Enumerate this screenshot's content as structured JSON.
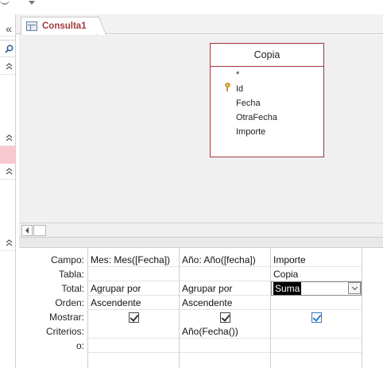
{
  "tab": {
    "label": "Consulta1"
  },
  "table": {
    "name": "Copia",
    "fields": [
      "*",
      "Id",
      "Fecha",
      "OtraFecha",
      "Importe"
    ]
  },
  "nav": {
    "collapse_glyph": "«"
  },
  "grid": {
    "row_labels": [
      "Campo:",
      "Tabla:",
      "Total:",
      "Orden:",
      "Mostrar:",
      "Criterios:",
      "o:"
    ],
    "columns": [
      {
        "campo": "Mes: Mes([Fecha])",
        "tabla": "",
        "total": "Agrupar por",
        "orden": "Ascendente",
        "mostrar": true,
        "criterios": ""
      },
      {
        "campo": "Año: Año([fecha])",
        "tabla": "",
        "total": "Agrupar por",
        "orden": "Ascendente",
        "mostrar": true,
        "criterios": "Año(Fecha())"
      },
      {
        "campo": "Importe",
        "tabla": "Copia",
        "total": "Suma",
        "orden": "",
        "mostrar": true,
        "criterios": ""
      }
    ]
  },
  "colors": {
    "accent": "#a4373a",
    "check_blue": "#2a7bd3",
    "pane_bg": "#f0f0f0"
  },
  "icons": [
    "collapse-icon",
    "search-icon",
    "expand-up-icon",
    "query-icon",
    "key-icon",
    "scroll-left-icon",
    "dropdown-icon",
    "checkbox-icon"
  ]
}
